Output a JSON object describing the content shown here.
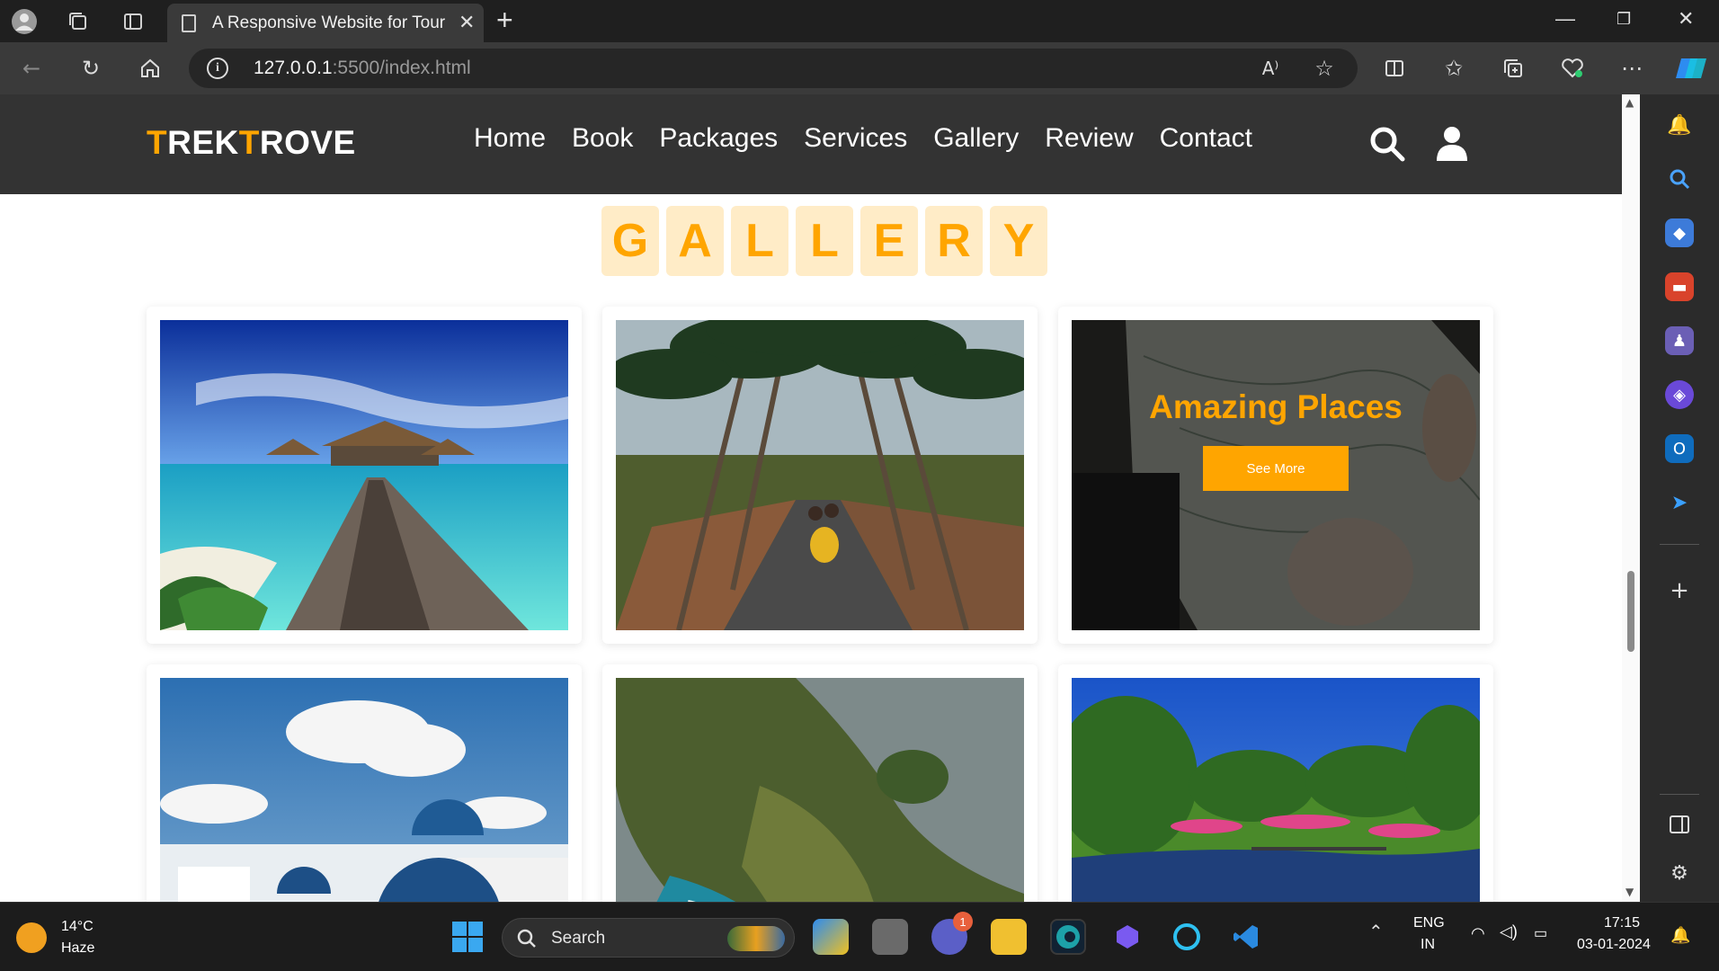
{
  "browser": {
    "tab_title": "A Responsive Website for Tour Ar",
    "url_host": "127.0.0.1",
    "url_rest": ":5500/index.html"
  },
  "site": {
    "logo_part1": "T",
    "logo_part2": "REK",
    "logo_part3": "T",
    "logo_part4": "ROVE",
    "nav": [
      "Home",
      "Book",
      "Packages",
      "Services",
      "Gallery",
      "Review",
      "Contact"
    ]
  },
  "gallery": {
    "heading_letters": [
      "G",
      "A",
      "L",
      "L",
      "E",
      "R",
      "Y"
    ],
    "overlay_title": "Amazing Places",
    "overlay_button": "See More"
  },
  "taskbar": {
    "weather_temp": "14°C",
    "weather_desc": "Haze",
    "search_placeholder": "Search",
    "chat_badge": "1",
    "lang_line1": "ENG",
    "lang_line2": "IN",
    "time": "17:15",
    "date": "03-01-2024"
  },
  "colors": {
    "accent": "#ffa500",
    "header_bg": "#333333",
    "heading_tile_bg": "#ffecc7"
  }
}
